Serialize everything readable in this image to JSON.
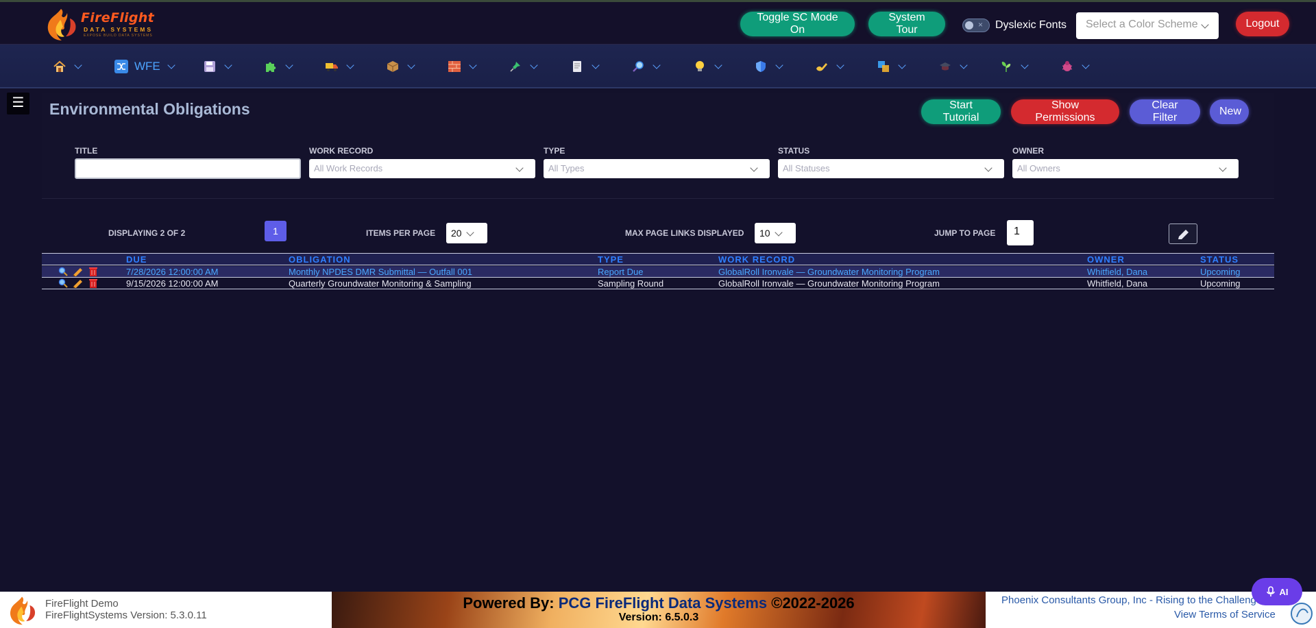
{
  "brand": {
    "name": "FireFlight",
    "sub": "DATA SYSTEMS",
    "tagline": "EXPOSE BUILD DATA SYSTEMS"
  },
  "header": {
    "toggle_sc": "Toggle SC Mode On",
    "system_tour": "System Tour",
    "dyslexic_label": "Dyslexic Fonts",
    "color_scheme_placeholder": "Select a Color Scheme",
    "logout": "Logout"
  },
  "nav": {
    "items": [
      {
        "icon": "home-icon",
        "label": ""
      },
      {
        "icon": "shuffle-icon",
        "label": "WFE"
      },
      {
        "icon": "floppy-icon",
        "label": ""
      },
      {
        "icon": "puzzle-icon",
        "label": ""
      },
      {
        "icon": "truck-icon",
        "label": ""
      },
      {
        "icon": "package-icon",
        "label": ""
      },
      {
        "icon": "brick-icon",
        "label": ""
      },
      {
        "icon": "pin-icon",
        "label": ""
      },
      {
        "icon": "document-icon",
        "label": ""
      },
      {
        "icon": "magnifier-icon",
        "label": ""
      },
      {
        "icon": "bulb-icon",
        "label": ""
      },
      {
        "icon": "shield-icon",
        "label": ""
      },
      {
        "icon": "hand-write-icon",
        "label": ""
      },
      {
        "icon": "squares-icon",
        "label": ""
      },
      {
        "icon": "grad-cap-icon",
        "label": ""
      },
      {
        "icon": "plant-icon",
        "label": ""
      },
      {
        "icon": "bug-icon",
        "label": ""
      }
    ],
    "accent": "#4da4ff"
  },
  "page": {
    "title": "Environmental Obligations",
    "actions": {
      "start_tutorial": "Start Tutorial",
      "show_permissions": "Show Permissions",
      "clear_filter": "Clear Filter",
      "new": "New"
    }
  },
  "filters": {
    "title_label": "TITLE",
    "title_value": "",
    "work_record_label": "WORK RECORD",
    "work_record_placeholder": "All Work Records",
    "type_label": "TYPE",
    "type_placeholder": "All Types",
    "status_label": "STATUS",
    "status_placeholder": "All Statuses",
    "owner_label": "OWNER",
    "owner_placeholder": "All Owners"
  },
  "pager": {
    "displaying": "DISPLAYING 2 OF 2",
    "current_page": "1",
    "items_per_page_label": "ITEMS PER PAGE",
    "items_per_page": "20",
    "max_links_label": "MAX PAGE LINKS DISPLAYED",
    "max_links": "10",
    "jump_label": "JUMP TO PAGE",
    "jump_value": "1"
  },
  "table": {
    "columns": [
      "DUE",
      "OBLIGATION",
      "TYPE",
      "WORK RECORD",
      "OWNER",
      "STATUS"
    ],
    "rows": [
      {
        "due": "7/28/2026 12:00:00 AM",
        "obligation": "Monthly NPDES DMR Submittal — Outfall 001",
        "type": "Report Due",
        "work_record": "GlobalRoll Ironvale — Groundwater Monitoring Program",
        "owner": "Whitfield, Dana",
        "status": "Upcoming"
      },
      {
        "due": "9/15/2026 12:00:00 AM",
        "obligation": "Quarterly Groundwater Monitoring & Sampling",
        "type": "Sampling Round",
        "work_record": "GlobalRoll Ironvale — Groundwater Monitoring Program",
        "owner": "Whitfield, Dana",
        "status": "Upcoming"
      }
    ]
  },
  "footer": {
    "demo_name": "FireFlight Demo",
    "demo_version": "FireFlightSystems Version: 5.3.0.11",
    "powered_prefix": "Powered By: ",
    "powered_brand": "PCG FireFlight Data Systems",
    "powered_suffix": " ©2022-2026",
    "version": "Version: 6.5.0.3",
    "pcg_tagline": "Phoenix Consultants Group, Inc - Rising to the Challenge",
    "terms": "View Terms of Service",
    "ai_label": "AI"
  }
}
